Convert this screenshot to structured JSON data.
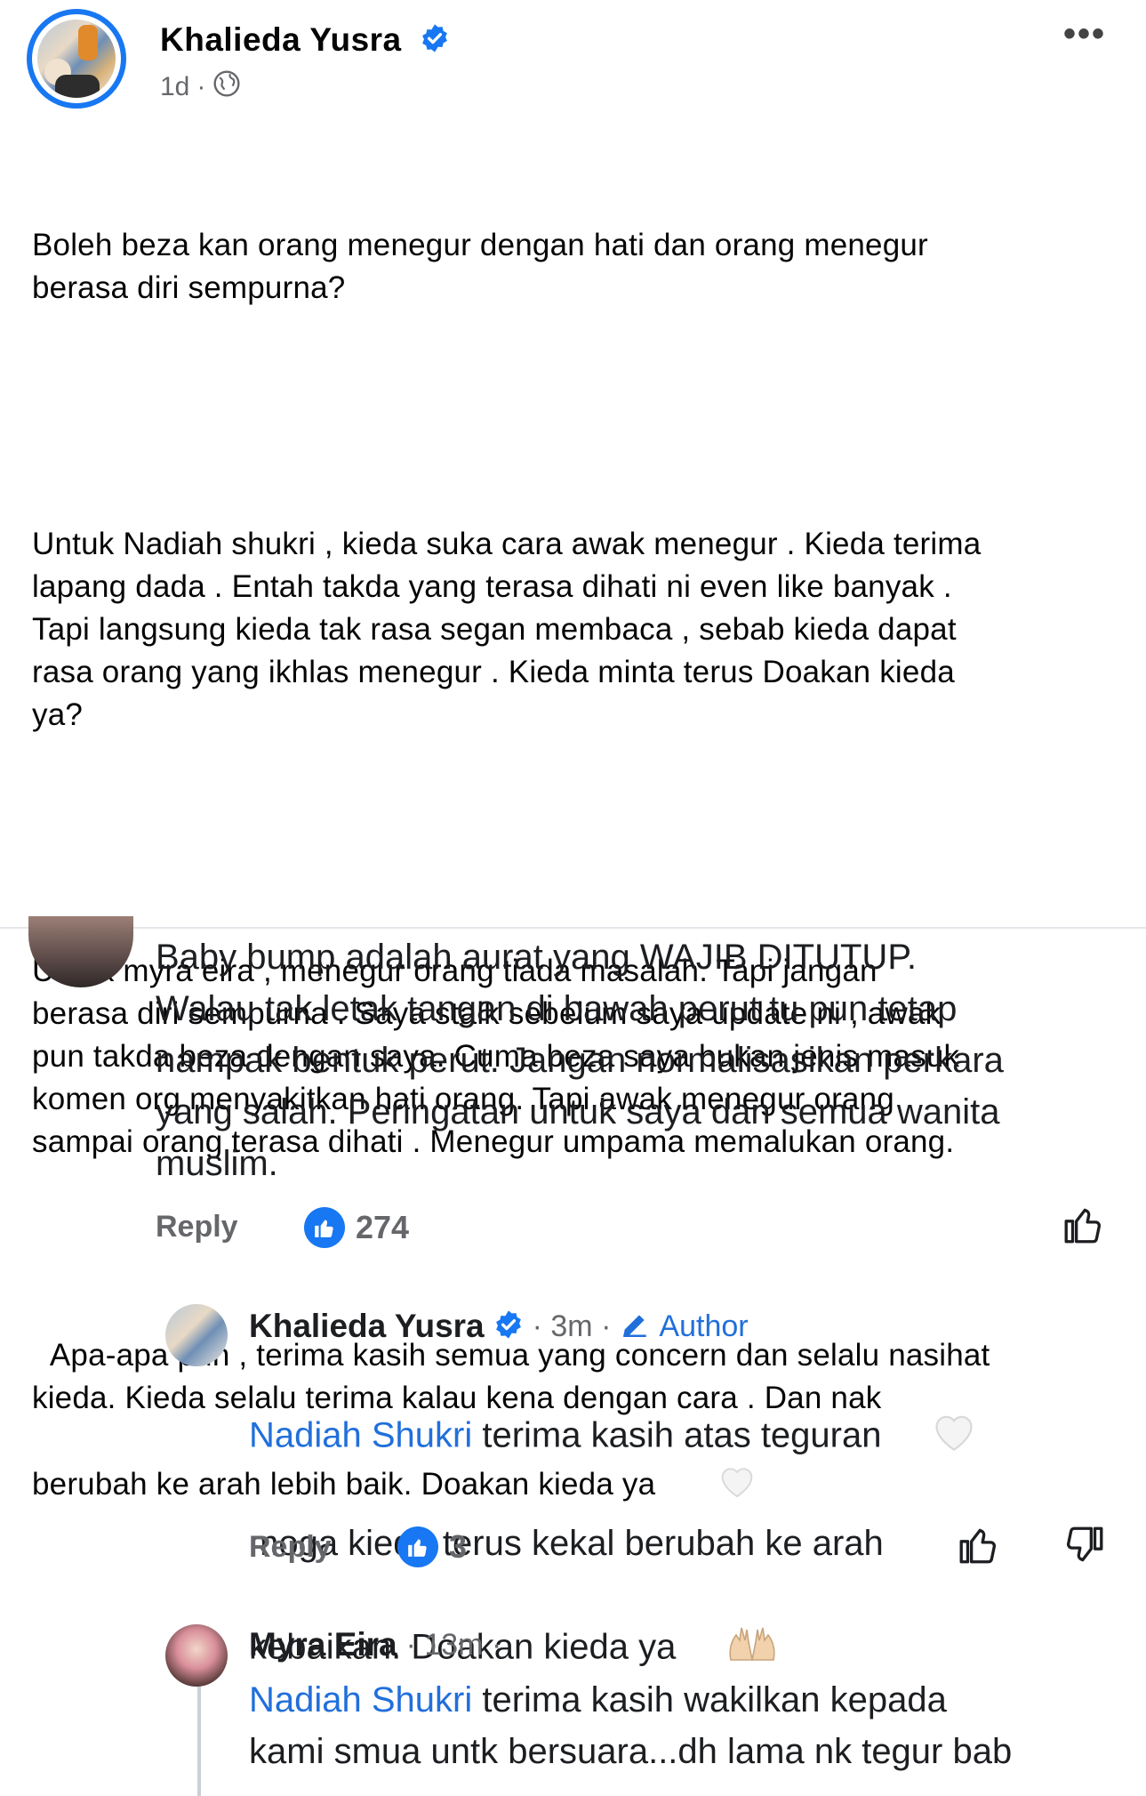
{
  "post": {
    "author": "Khalieda Yusra",
    "time": "1d",
    "visibility_icon": "globe-icon",
    "more_icon": "more-horizontal-icon",
    "paragraphs": [
      "Boleh beza kan orang menegur dengan hati dan orang menegur\nberasa diri sempurna?",
      "Untuk Nadiah shukri , kieda suka cara awak menegur . Kieda terima\nlapang dada . Entah takda yang terasa dihati ni even like banyak .\nTapi langsung kieda tak rasa segan membaca , sebab kieda dapat\nrasa orang yang ikhlas menegur . Kieda minta terus Doakan kieda\nya?",
      "Untuk myra eira , menegur orang tiada masalah. Tapi jangan\nberasa diri sempurna . Saya stalk sebelum saya update ni , awak\npun takda beza dengan saya. Cuma beza saya bukan jenis masuk\nkomen org menyakitkan hati orang. Tapi awak menegur orang\nsampai orang terasa dihati . Menegur umpama memalukan orang.",
      "Apa-apa pun , terima kasih semua yang concern dan selalu nasihat\nkieda. Kieda selalu terima kalau kena dengan cara . Dan nak\nberubah ke arah lebih baik. Doakan kieda ya"
    ]
  },
  "comments": {
    "first": {
      "text": "Baby bump adalah aurat yang WAJIB DITUTUP.\nWalau tak letak tangan di bawah perut tu pun tetap\nnampak bentuk perut. Jangan normalisasikan perkara\nyang salah. Peringatan untuk saya dan semua wanita\nmuslim.",
      "reply_label": "Reply",
      "like_count": "274"
    },
    "author_reply": {
      "name": "Khalieda Yusra",
      "time": "· 3m ·",
      "badge": "Author",
      "mention": "Nadiah Shukri",
      "text_line1": " terima kasih atas teguran ",
      "text_rest": "moga kieda terus kekal berubah ke arah\nkebaikan. Doakan kieda ya ",
      "reply_label": "Reply",
      "like_count": "3"
    },
    "myra_reply": {
      "name": "Myra Eira",
      "time": "· 13m ·",
      "mention": "Nadiah Shukri",
      "text_line1": " terima kasih wakilkan kepada",
      "text_line2": "kami smua untk bersuara...dh lama nk tegur bab"
    }
  },
  "colors": {
    "brand_blue": "#1877f2",
    "link_blue": "#216fdb",
    "muted": "#65676b"
  }
}
